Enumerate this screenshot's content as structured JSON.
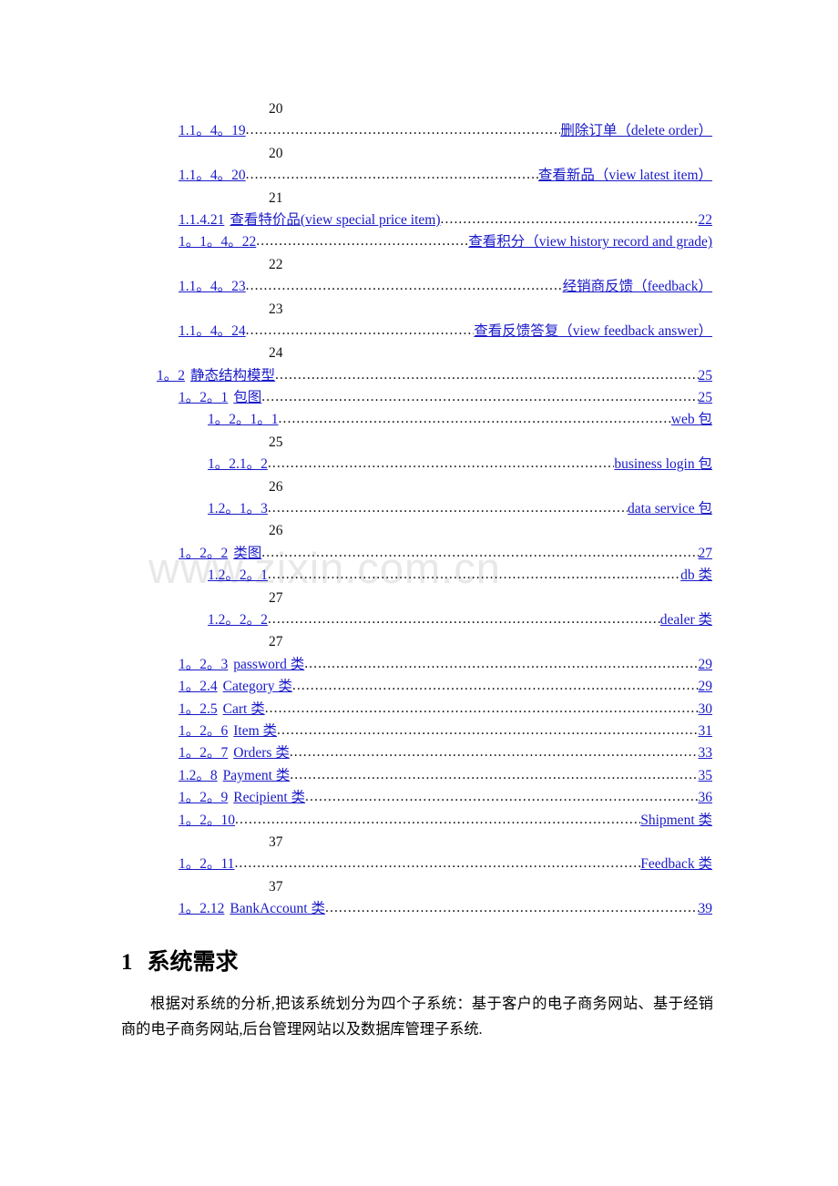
{
  "document": {
    "watermark": "www.zixin.com.cn",
    "link_color": "#1a1ac8",
    "text_color": "#111111"
  },
  "toc": {
    "rows": [
      {
        "kind": "cont",
        "indent": 2,
        "page": "20"
      },
      {
        "kind": "entry",
        "indent": 1,
        "num": "1.1。4。19",
        "tail": "删除订单（delete order）"
      },
      {
        "kind": "cont",
        "indent": 2,
        "page": "20"
      },
      {
        "kind": "entry",
        "indent": 1,
        "num": "1.1。4。20",
        "tail": "查看新品（view latest item）"
      },
      {
        "kind": "cont",
        "indent": 2,
        "page": "21"
      },
      {
        "kind": "entry",
        "indent": 1,
        "num": "1.1.4.21",
        "title": "查看特价品(view special price item)",
        "tail": "22"
      },
      {
        "kind": "entry",
        "indent": 1,
        "num": "1。1。4。22",
        "tail": "查看积分（view history record and grade)"
      },
      {
        "kind": "cont",
        "indent": 2,
        "page": "22"
      },
      {
        "kind": "entry",
        "indent": 1,
        "num": "1.1。4。23",
        "tail": "经销商反馈（feedback）"
      },
      {
        "kind": "cont",
        "indent": 2,
        "page": "23"
      },
      {
        "kind": "entry",
        "indent": 1,
        "num": "1.1。4。24",
        "tail": "查看反馈答复（view feedback answer）"
      },
      {
        "kind": "cont",
        "indent": 2,
        "page": "24"
      },
      {
        "kind": "entry",
        "indent": 0,
        "num": "1。2",
        "title": "静态结构模型",
        "tail": "25"
      },
      {
        "kind": "entry",
        "indent": 1,
        "num": "1。2。1",
        "title": "包图",
        "tail": "25"
      },
      {
        "kind": "entry",
        "indent": 2,
        "num": "1。2。1。1",
        "tail": "web 包"
      },
      {
        "kind": "cont",
        "indent": 2,
        "page": "25"
      },
      {
        "kind": "entry",
        "indent": 2,
        "num": "1。2.1。2",
        "tail": "business login 包"
      },
      {
        "kind": "cont",
        "indent": 2,
        "page": "26"
      },
      {
        "kind": "entry",
        "indent": 2,
        "num": "1.2。1。3",
        "tail": "data service 包"
      },
      {
        "kind": "cont",
        "indent": 2,
        "page": "26"
      },
      {
        "kind": "entry",
        "indent": 1,
        "num": "1。2。2",
        "title": "类图",
        "tail": "27"
      },
      {
        "kind": "entry",
        "indent": 2,
        "num": "1.2。2。1",
        "tail": "db 类"
      },
      {
        "kind": "cont",
        "indent": 2,
        "page": "27"
      },
      {
        "kind": "entry",
        "indent": 2,
        "num": "1.2。2。2",
        "tail": "dealer 类"
      },
      {
        "kind": "cont",
        "indent": 2,
        "page": "27"
      },
      {
        "kind": "entry",
        "indent": 1,
        "num": "1。2。3",
        "title": "password 类",
        "tail": "29"
      },
      {
        "kind": "entry",
        "indent": 1,
        "num": "1。2.4",
        "title": "Category 类",
        "tail": "29"
      },
      {
        "kind": "entry",
        "indent": 1,
        "num": "1。2.5",
        "title": "Cart 类",
        "tail": "30"
      },
      {
        "kind": "entry",
        "indent": 1,
        "num": "1。2。6",
        "title": "Item 类",
        "tail": "31"
      },
      {
        "kind": "entry",
        "indent": 1,
        "num": "1。2。7",
        "title": "Orders 类",
        "tail": "33"
      },
      {
        "kind": "entry",
        "indent": 1,
        "num": "1.2。8",
        "title": "Payment 类",
        "tail": "35"
      },
      {
        "kind": "entry",
        "indent": 1,
        "num": "1。2。9",
        "title": "Recipient 类",
        "tail": "36"
      },
      {
        "kind": "entry",
        "indent": 1,
        "num": "1。2。10",
        "tail": "Shipment 类"
      },
      {
        "kind": "cont",
        "indent": 2,
        "page": "37"
      },
      {
        "kind": "entry",
        "indent": 1,
        "num": "1。2。11",
        "tail": "Feedback 类"
      },
      {
        "kind": "cont",
        "indent": 2,
        "page": "37"
      },
      {
        "kind": "entry",
        "indent": 1,
        "num": "1。2.12",
        "title": "BankAccount 类",
        "tail": "39"
      }
    ]
  },
  "section": {
    "number": "1",
    "title": "系统需求",
    "paragraph": "根据对系统的分析,把该系统划分为四个子系统：基于客户的电子商务网站、基于经销商的电子商务网站,后台管理网站以及数据库管理子系统."
  }
}
